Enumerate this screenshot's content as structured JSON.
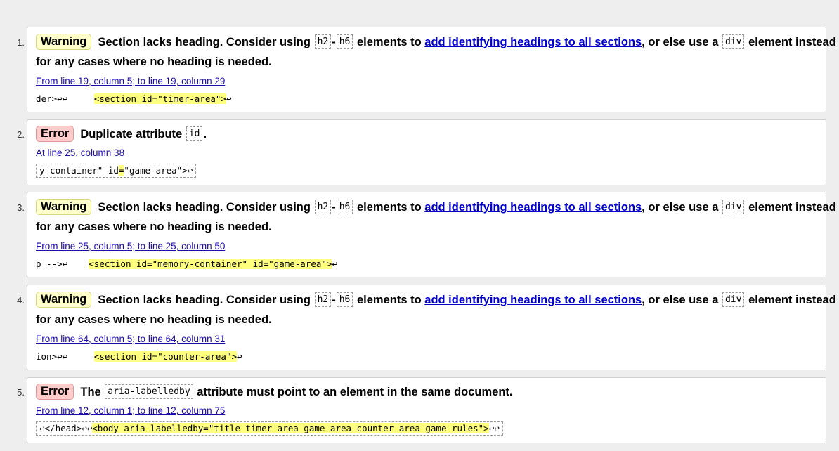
{
  "messages": [
    {
      "number": "1.",
      "type": "Warning",
      "text_before": "Section lacks heading. Consider using",
      "code1": "h2",
      "sep": "-",
      "code2": "h6",
      "text_mid": "elements to",
      "link": "add identifying headings to all sections",
      "text_after": ", or else use a",
      "code3": "div",
      "text_end": "element instead",
      "text_line2": "for any cases where no heading is needed.",
      "location": "From line 19, column 5; to line 19, column 29",
      "extract_pre": "der>↩↩     ",
      "extract_hl": "<section id=\"timer-area\">",
      "extract_post": "↩"
    },
    {
      "number": "2.",
      "type": "Error",
      "text_before": "Duplicate attribute",
      "code1": "id",
      "text_after": ".",
      "location": "At line 25, column 38",
      "extract_pre": "y-container\" id",
      "extract_hl": "=",
      "extract_post": "\"game-area\">↩"
    },
    {
      "number": "3.",
      "type": "Warning",
      "text_before": "Section lacks heading. Consider using",
      "code1": "h2",
      "sep": "-",
      "code2": "h6",
      "text_mid": "elements to",
      "link": "add identifying headings to all sections",
      "text_after": ", or else use a",
      "code3": "div",
      "text_end": "element instead",
      "text_line2": "for any cases where no heading is needed.",
      "location": "From line 25, column 5; to line 25, column 50",
      "extract_pre": "p -->↩    ",
      "extract_hl": "<section id=\"memory-container\" id=\"game-area\">",
      "extract_post": "↩"
    },
    {
      "number": "4.",
      "type": "Warning",
      "text_before": "Section lacks heading. Consider using",
      "code1": "h2",
      "sep": "-",
      "code2": "h6",
      "text_mid": "elements to",
      "link": "add identifying headings to all sections",
      "text_after": ", or else use a",
      "code3": "div",
      "text_end": "element instead",
      "text_line2": "for any cases where no heading is needed.",
      "location": "From line 64, column 5; to line 64, column 31",
      "extract_pre": "ion>↩↩     ",
      "extract_hl": "<section id=\"counter-area\">",
      "extract_post": "↩"
    },
    {
      "number": "5.",
      "type": "Error",
      "text_before": "The",
      "code1": "aria-labelledby",
      "text_after": "attribute must point to an element in the same document.",
      "location": "From line 12, column 1; to line 12, column 75",
      "extract_pre": "↩</head>↩↩",
      "extract_hl": "<body aria-labelledby=\"title timer-area game-area counter-area game-rules\">",
      "extract_post": "↩↩"
    }
  ],
  "colors": {
    "warning_bg": "#ffffcc",
    "error_bg": "#ffcccc",
    "highlight": "#ffff80",
    "link": "#0000cc"
  }
}
